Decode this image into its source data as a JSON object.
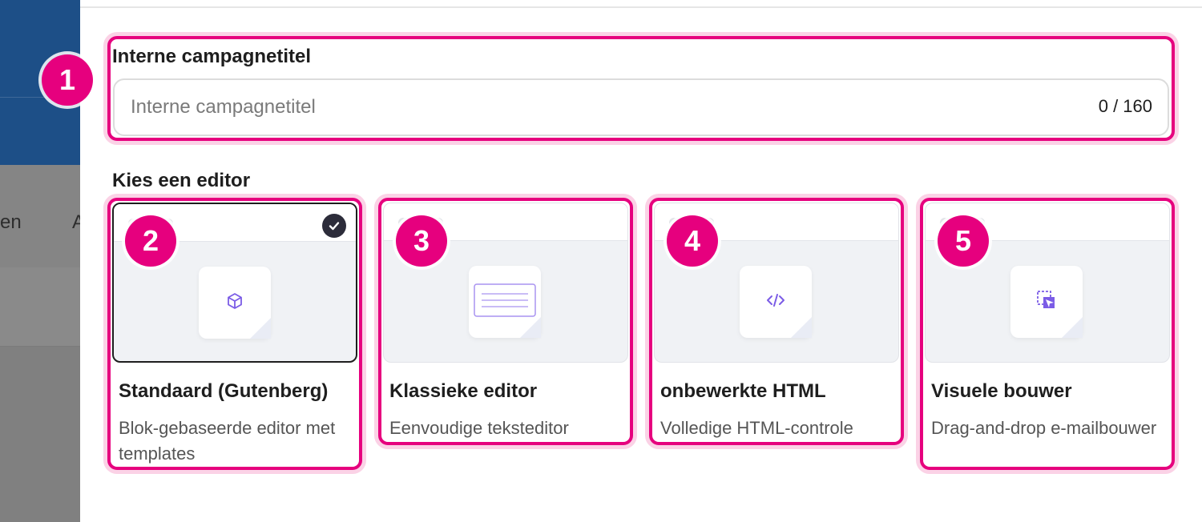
{
  "background": {
    "nav_fragment_left": "en",
    "nav_fragment_right": "A"
  },
  "campaign_title": {
    "label": "Interne campagnetitel",
    "placeholder": "Interne campagnetitel",
    "value": "",
    "counter": "0 / 160"
  },
  "editor_section": {
    "label": "Kies een editor",
    "options": [
      {
        "name": "Standaard (Gutenberg)",
        "description": "Blok-gebaseerde editor met templates",
        "icon": "cube-icon",
        "selected": true
      },
      {
        "name": "Klassieke editor",
        "description": "Eenvoudige teksteditor",
        "icon": "text-lines-icon",
        "selected": false
      },
      {
        "name": "onbewerkte HTML",
        "description": "Volledige HTML-controle",
        "icon": "code-icon",
        "selected": false
      },
      {
        "name": "Visuele bouwer",
        "description": "Drag-and-drop e-mailbouwer",
        "icon": "drag-drop-icon",
        "selected": false
      }
    ]
  },
  "annotations": [
    "1",
    "2",
    "3",
    "4",
    "5"
  ],
  "colors": {
    "highlight": "#e6007e",
    "icon_accent": "#7b5ce6",
    "header_blue": "#1d4f87"
  }
}
